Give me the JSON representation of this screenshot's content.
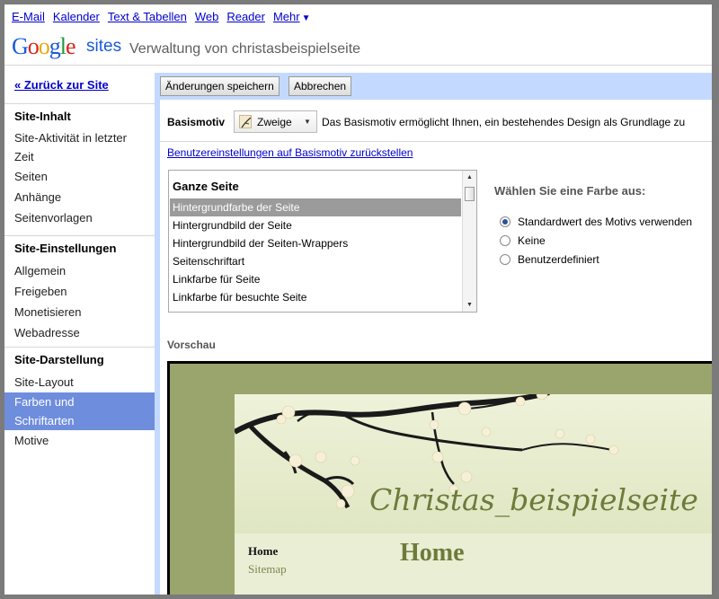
{
  "topnav": {
    "links": [
      "E-Mail",
      "Kalender",
      "Text & Tabellen",
      "Web",
      "Reader",
      "Mehr"
    ],
    "more_icon": "chevron-down-icon"
  },
  "header": {
    "logo_letters": [
      "G",
      "o",
      "o",
      "g",
      "l",
      "e"
    ],
    "product": "sites",
    "title": "Verwaltung von christasbeispielseite"
  },
  "sidebar": {
    "back_link": "« Zurück zur Site",
    "sections": [
      {
        "title": "Site-Inhalt",
        "items": [
          "Site-Aktivität in letzter",
          "Zeit",
          "Seiten",
          "Anhänge",
          "Seitenvorlagen"
        ]
      },
      {
        "title": "Site-Einstellungen",
        "items": [
          "Allgemein",
          "Freigeben",
          "Monetisieren",
          "Webadresse"
        ]
      },
      {
        "title": "Site-Darstellung",
        "items": [
          "Site-Layout",
          "Farben und",
          "Schriftarten",
          "Motive"
        ]
      }
    ],
    "selected_item": "Farben und Schriftarten"
  },
  "toolbar": {
    "save_label": "Änderungen speichern",
    "cancel_label": "Abbrechen"
  },
  "theme": {
    "label": "Basismotiv",
    "selected": "Zweige",
    "description": "Das Basismotiv ermöglicht Ihnen, ein bestehendes Design als Grundlage zu",
    "reset_link": "Benutzereinstellungen auf Basismotiv zurückstellen"
  },
  "elements_list": {
    "header": "Ganze Seite",
    "items": [
      "Hintergrundfarbe der Seite",
      "Hintergrundbild der Seite",
      "Hintergrundbild der Seiten-Wrappers",
      "Seitenschriftart",
      "Linkfarbe für Seite",
      "Linkfarbe für besuchte Seite"
    ],
    "selected_index": 0
  },
  "color_picker": {
    "heading": "Wählen Sie eine Farbe aus:",
    "options": [
      "Standardwert des Motivs verwenden",
      "Keine",
      "Benutzerdefiniert"
    ],
    "selected_index": 0
  },
  "preview": {
    "label": "Vorschau",
    "site_title": "Christas_beispielseite",
    "nav": [
      "Home",
      "Sitemap"
    ],
    "page_heading": "Home"
  },
  "colors": {
    "link": "#0000cc",
    "sidebar_selected": "#6f8ddd",
    "main_bg": "#c3d9ff",
    "preview_olive": "#9aa56e",
    "preview_title": "#6d7b3a"
  }
}
